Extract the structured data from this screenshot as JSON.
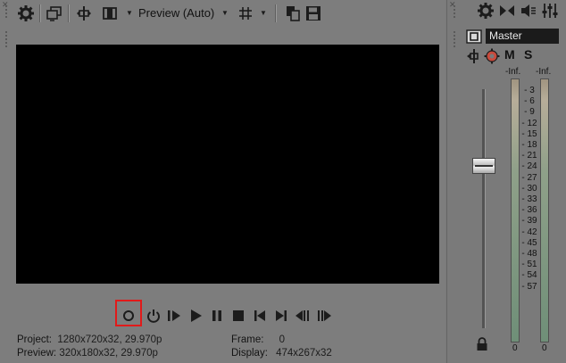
{
  "preview": {
    "mode_label": "Preview (Auto)",
    "toolbar_icons": [
      "gear-icon",
      "external-monitor-icon",
      "split-screen-icon",
      "overlays-icon",
      "grid-icon",
      "copy-snapshot-icon",
      "save-snapshot-icon"
    ],
    "transport_icons": [
      "record-icon",
      "loop-icon",
      "play-from-start-icon",
      "play-icon",
      "pause-icon",
      "stop-icon",
      "go-to-start-icon",
      "go-to-end-icon",
      "previous-frame-icon",
      "next-frame-icon"
    ],
    "record_highlight_color": "#e21a1a",
    "project_label": "Project:",
    "project_value": "1280x720x32, 29.970p",
    "preview_label": "Preview:",
    "preview_value": "320x180x32, 29.970p",
    "frame_label": "Frame:",
    "frame_value": "0",
    "display_label": "Display:",
    "display_value": "474x267x32"
  },
  "mixer": {
    "toolbar_icons": [
      "gear-icon",
      "downmix-icon",
      "mute-speaker-icon",
      "fx-sliders-icon"
    ],
    "master_label": "Master",
    "mute_label": "M",
    "solo_label": "S",
    "left_peak": "-Inf.",
    "right_peak": "-Inf.",
    "scale": [
      "3",
      "6",
      "9",
      "12",
      "15",
      "18",
      "21",
      "24",
      "27",
      "30",
      "33",
      "36",
      "39",
      "42",
      "45",
      "48",
      "51",
      "54",
      "57"
    ],
    "left_zero": "0",
    "right_zero": "0",
    "fader_level": 0.32
  }
}
